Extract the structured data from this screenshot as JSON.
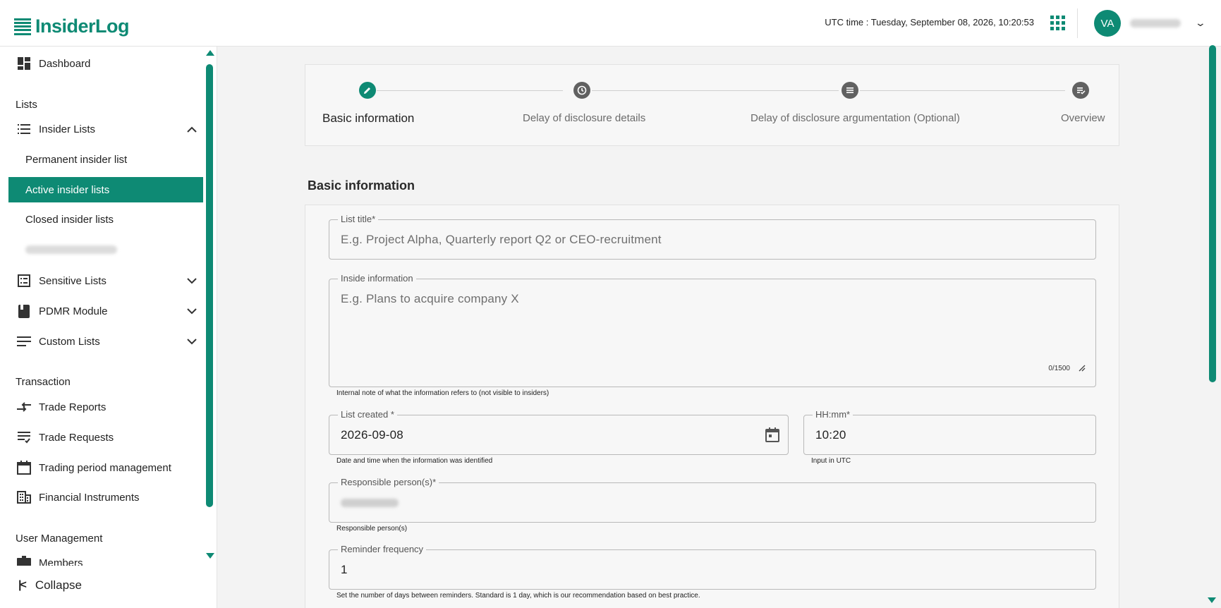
{
  "app": {
    "logo_text": "InsiderLog",
    "brand_color": "#0e8a74"
  },
  "header": {
    "utc_time": "UTC time : Tuesday, September 08, 2026, 10:20:53",
    "avatar_initials": "VA"
  },
  "sidebar": {
    "dashboard": "Dashboard",
    "sections": {
      "lists": "Lists",
      "transaction": "Transaction",
      "user_management": "User Management"
    },
    "insider_lists": "Insider Lists",
    "insider_sub": {
      "permanent": "Permanent insider list",
      "active": "Active insider lists",
      "closed": "Closed insider lists"
    },
    "sensitive_lists": "Sensitive Lists",
    "pdmr_module": "PDMR Module",
    "custom_lists": "Custom Lists",
    "trade_reports": "Trade Reports",
    "trade_requests": "Trade Requests",
    "trading_period": "Trading period management",
    "financial_instruments": "Financial Instruments",
    "members": "Members",
    "collapse": "Collapse"
  },
  "stepper": {
    "steps": [
      {
        "label": "Basic information",
        "icon": "pencil-icon",
        "active": true
      },
      {
        "label": "Delay of disclosure details",
        "icon": "clock-icon",
        "active": false
      },
      {
        "label": "Delay of disclosure argumentation (Optional)",
        "icon": "list-icon",
        "active": false
      },
      {
        "label": "Overview",
        "icon": "checklist-icon",
        "active": false
      }
    ]
  },
  "form": {
    "section_title": "Basic information",
    "list_title": {
      "label": "List title*",
      "placeholder": "E.g. Project Alpha, Quarterly report Q2 or CEO-recruitment"
    },
    "inside_information": {
      "label": "Inside information",
      "placeholder": "E.g. Plans to acquire company X",
      "counter": "0/1500",
      "hint": "Internal note of what the information refers to (not visible to insiders)"
    },
    "list_created": {
      "label": "List created *",
      "value": "2026-09-08",
      "hint": "Date and time when the information was identified"
    },
    "time": {
      "label": "HH:mm*",
      "value": "10:20",
      "hint": "Input in UTC"
    },
    "responsible": {
      "label": "Responsible person(s)*",
      "hint": "Responsible person(s)"
    },
    "reminder": {
      "label": "Reminder frequency",
      "value": "1",
      "hint": "Set the number of days between reminders. Standard is 1 day, which is our recommendation based on best practice."
    }
  }
}
